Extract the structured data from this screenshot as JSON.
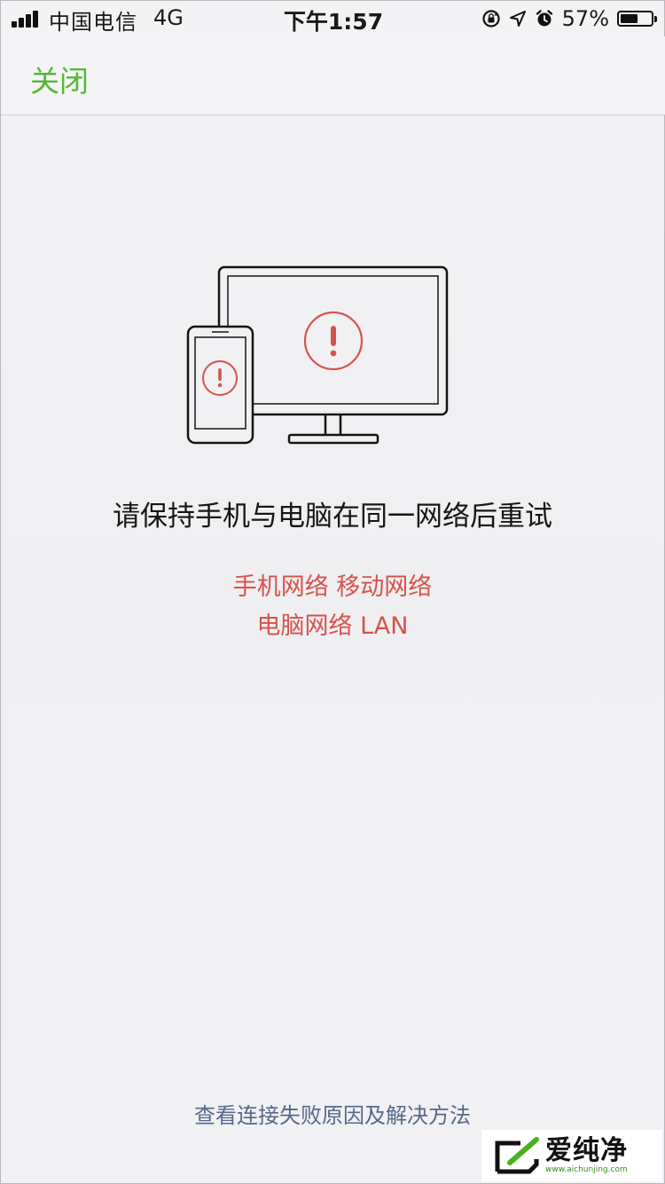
{
  "status_bar": {
    "carrier": "中国电信",
    "network_type": "4G",
    "time": "下午1:57",
    "battery_percent": "57%",
    "battery_level": 0.57,
    "icons": [
      "signal-icon",
      "rotation-lock-icon",
      "location-arrow-icon",
      "alarm-icon",
      "battery-icon"
    ]
  },
  "nav": {
    "close_label": "关闭"
  },
  "illustration": {
    "icons": [
      "monitor-icon",
      "phone-icon",
      "warning-icon"
    ],
    "accent_color": "#d6524c"
  },
  "content": {
    "message": "请保持手机与电脑在同一网络后重试",
    "phone_network": "手机网络 移动网络",
    "pc_network": "电脑网络 LAN"
  },
  "footer": {
    "help_link": "查看连接失败原因及解决方法"
  },
  "watermark": {
    "title": "爱纯净",
    "url": "www.aichunjing.com"
  },
  "colors": {
    "close_green": "#55b837",
    "warning_red": "#d6524c",
    "link_blue": "#57678c",
    "background": "#f1f1f3"
  }
}
